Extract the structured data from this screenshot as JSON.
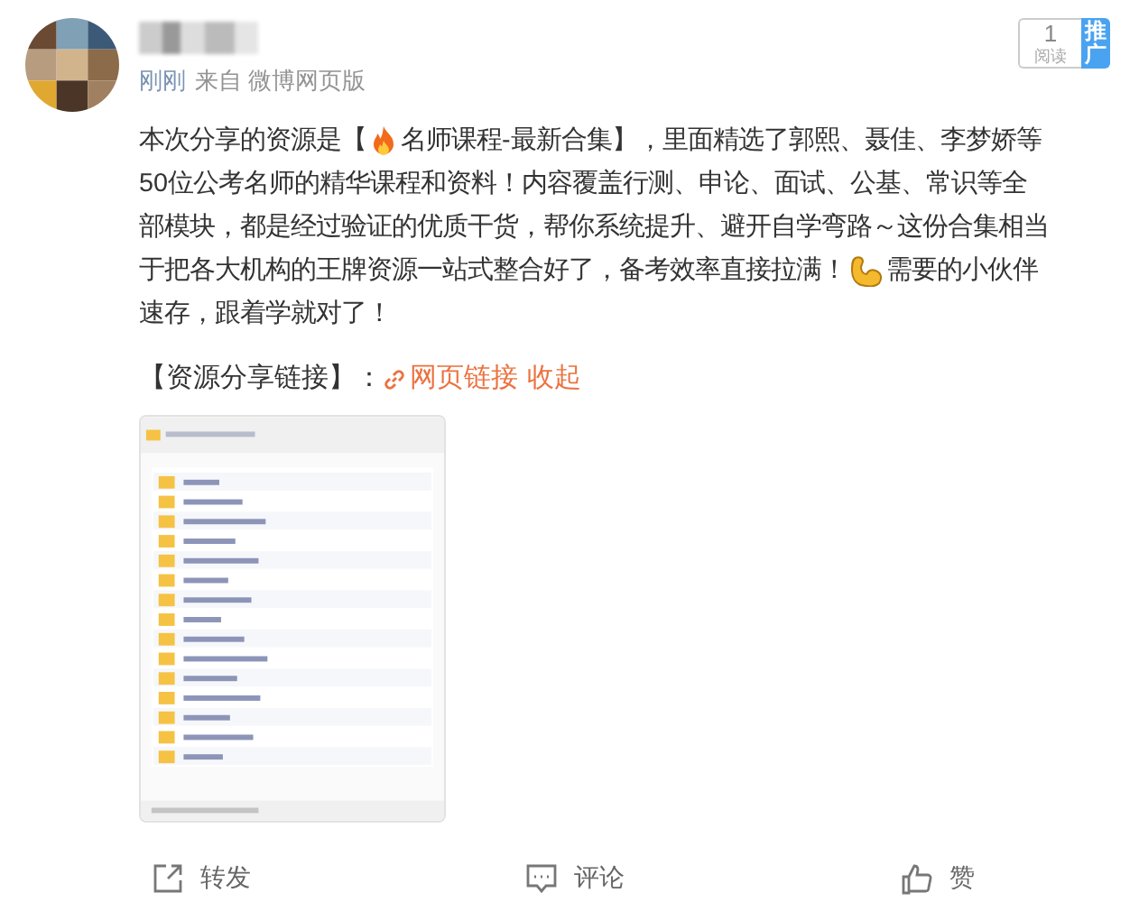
{
  "post": {
    "meta": [
      {
        "text": "刚刚",
        "kind": "time"
      },
      {
        "text": "来自 微博网页版",
        "kind": "source"
      }
    ],
    "read_count": {
      "count": "1",
      "label": "阅读"
    },
    "promote_tag": "推广",
    "body": [
      [
        {
          "kind": "text",
          "text": "本次分享的资源是【"
        },
        {
          "kind": "fire"
        },
        {
          "kind": "text",
          "text": "名师课程-最新合集】，里面精选了郭熙、聂佳、李梦娇等"
        }
      ],
      [
        {
          "kind": "text",
          "text": "50位公考名师的精华课程和资料！内容覆盖行测、申论、面试、公基、常识等全"
        }
      ],
      [
        {
          "kind": "text",
          "text": "部模块，都是经过验证的优质干货，帮你系统提升、避开自学弯路～这份合集相当"
        }
      ],
      [
        {
          "kind": "text",
          "text": "于把各大机构的王牌资源一站式整合好了，备考效率直接拉满！"
        },
        {
          "kind": "muscle"
        },
        {
          "kind": "text",
          "text": "需要的小伙伴"
        }
      ],
      [
        {
          "kind": "text",
          "text": "速存，跟着学就对了！"
        }
      ]
    ],
    "link_line": {
      "label": "【资源分享链接】：",
      "link": "网页链接",
      "collapse": "收起"
    },
    "actions": [
      {
        "kind": "forward",
        "label": "转发"
      },
      {
        "kind": "comment",
        "label": "评论"
      },
      {
        "kind": "like",
        "label": "赞"
      }
    ]
  }
}
